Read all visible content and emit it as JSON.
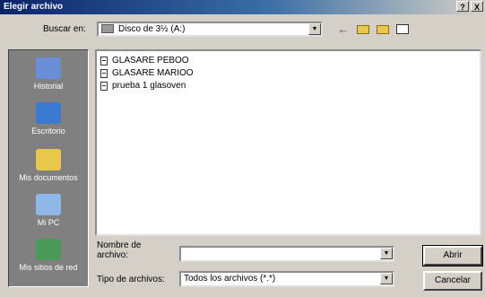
{
  "window": {
    "title": "Elegir archivo",
    "controls": [
      "?",
      "X"
    ]
  },
  "lookin": {
    "label": "Buscar en:",
    "value": "Disco de 3½ (A:)"
  },
  "places": [
    {
      "label": "Historial",
      "icon": "history-icon",
      "color": "#6a8fd8"
    },
    {
      "label": "Escritorio",
      "icon": "desktop-icon",
      "color": "#3a7ad0"
    },
    {
      "label": "Mis documentos",
      "icon": "my-documents-icon",
      "color": "#e8c84a"
    },
    {
      "label": "Mi PC",
      "icon": "my-computer-icon",
      "color": "#8fb8e8"
    },
    {
      "label": "Mis sitios de red",
      "icon": "network-places-icon",
      "color": "#4a9a5a"
    }
  ],
  "files": [
    {
      "name": "GLASARE PEBOO"
    },
    {
      "name": "GLASARE MARIOO"
    },
    {
      "name": "prueba 1 glasoven"
    }
  ],
  "filename": {
    "label": "Nombre de archivo:",
    "value": ""
  },
  "filetype": {
    "label": "Tipo de archivos:",
    "value": "Todos los archivos (*.*)"
  },
  "buttons": {
    "open": "Abrir",
    "cancel": "Cancelar"
  }
}
